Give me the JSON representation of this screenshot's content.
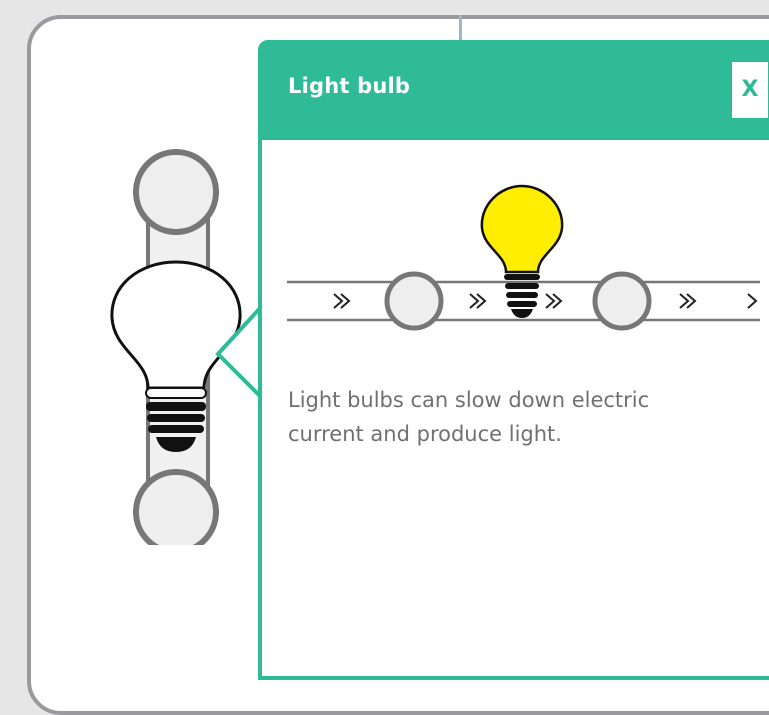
{
  "popup": {
    "title": "Light bulb",
    "close_label": "X",
    "description": "Light bulbs can slow down electric current and produce light."
  },
  "colors": {
    "accent": "#2fbb98",
    "panel_border": "#9a9a9e",
    "bulb_fill": "#ffee00",
    "wire": "#9fb4c6",
    "text": "#707070"
  },
  "icons": {
    "component": "light-bulb-icon",
    "illustration": "light-bulb-circuit-icon",
    "flow_arrow": "chevron-right-icon"
  }
}
